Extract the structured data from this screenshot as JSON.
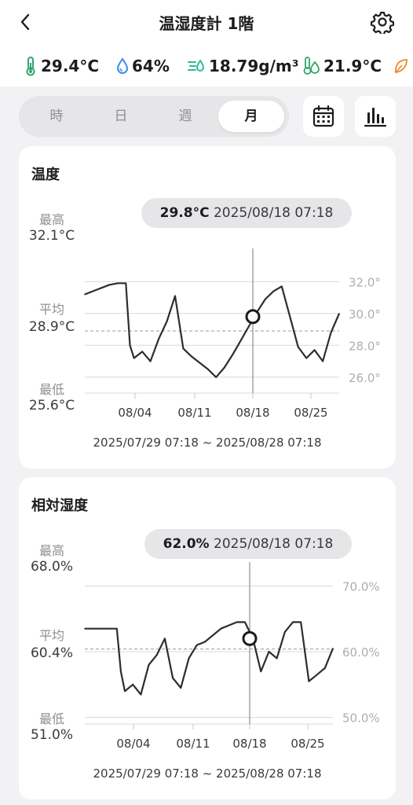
{
  "header": {
    "title": "温湿度計 1階"
  },
  "readings": {
    "temperature": "29.4°C",
    "humidity": "64%",
    "absolute_humidity": "18.79g/m³",
    "dew_point": "21.9°C"
  },
  "colors": {
    "temp_icon": "#2fa66a",
    "humidity_icon": "#3a8ee6",
    "abs_humidity_icon": "#2fb89a",
    "dew_icon": "#2fa66a",
    "leaf_icon": "#f08a24"
  },
  "period_tabs": [
    {
      "label": "時",
      "active": false
    },
    {
      "label": "日",
      "active": false
    },
    {
      "label": "週",
      "active": false
    },
    {
      "label": "月",
      "active": true
    }
  ],
  "temp_card": {
    "title": "温度",
    "max_label": "最高",
    "max_value": "32.1°C",
    "avg_label": "平均",
    "avg_value": "28.9°C",
    "min_label": "最低",
    "min_value": "25.6°C",
    "selected_value": "29.8°C",
    "selected_time": "2025/08/18 07:18",
    "range": "2025/07/29 07:18 ~ 2025/08/28 07:18"
  },
  "humidity_card": {
    "title": "相対湿度",
    "max_label": "最高",
    "max_value": "68.0%",
    "avg_label": "平均",
    "avg_value": "60.4%",
    "min_label": "最低",
    "min_value": "51.0%",
    "selected_value": "62.0%",
    "selected_time": "2025/08/18 07:18",
    "range": "2025/07/29 07:18 ~ 2025/08/28 07:18"
  },
  "chart_data": [
    {
      "type": "line",
      "title": "温度",
      "x_ticks": [
        "08/04",
        "08/11",
        "08/18",
        "08/25"
      ],
      "y_ticks": [
        "32.0°",
        "30.0°",
        "28.0°",
        "26.0°"
      ],
      "ylim": [
        25.0,
        33.0
      ],
      "average": 28.9,
      "grid": true,
      "selected": {
        "x": "08/18",
        "value": 29.8
      },
      "x": [
        0,
        1,
        2,
        3,
        4,
        5,
        5.5,
        6,
        7,
        8,
        9,
        10,
        11,
        12,
        13,
        14,
        15,
        16,
        17,
        18,
        19,
        20,
        21,
        22,
        23,
        24,
        25,
        26,
        27,
        28,
        29,
        30,
        31
      ],
      "values": [
        31.2,
        31.4,
        31.6,
        31.8,
        31.9,
        31.9,
        28.0,
        27.2,
        27.6,
        27.0,
        28.4,
        29.5,
        31.1,
        27.8,
        27.3,
        26.9,
        26.5,
        26.0,
        26.6,
        27.4,
        28.3,
        29.2,
        30.1,
        30.9,
        31.4,
        31.7,
        29.8,
        27.9,
        27.2,
        27.7,
        27.0,
        28.8,
        30.0
      ]
    },
    {
      "type": "line",
      "title": "相対湿度",
      "x_ticks": [
        "08/04",
        "08/11",
        "08/18",
        "08/25"
      ],
      "y_ticks": [
        "70.0%",
        "60.0%",
        "50.0%"
      ],
      "ylim": [
        49.0,
        71.0
      ],
      "average": 60.4,
      "grid": true,
      "selected": {
        "x": "08/18",
        "value": 62.0
      },
      "x": [
        0,
        1,
        2,
        3,
        4,
        4.5,
        5,
        6,
        7,
        8,
        9,
        10,
        11,
        12,
        13,
        14,
        15,
        16,
        17,
        18,
        19,
        20,
        21,
        22,
        23,
        24,
        25,
        26,
        27,
        28,
        29,
        30,
        31
      ],
      "values": [
        63.5,
        63.5,
        63.5,
        63.5,
        63.5,
        57.0,
        54.0,
        55.0,
        53.5,
        58.0,
        59.5,
        62.0,
        56.0,
        54.5,
        59.0,
        61.0,
        61.5,
        62.5,
        63.5,
        64.0,
        64.5,
        64.5,
        62.0,
        57.0,
        60.0,
        59.0,
        63.0,
        64.5,
        64.5,
        55.5,
        56.5,
        57.5,
        60.5
      ]
    }
  ]
}
